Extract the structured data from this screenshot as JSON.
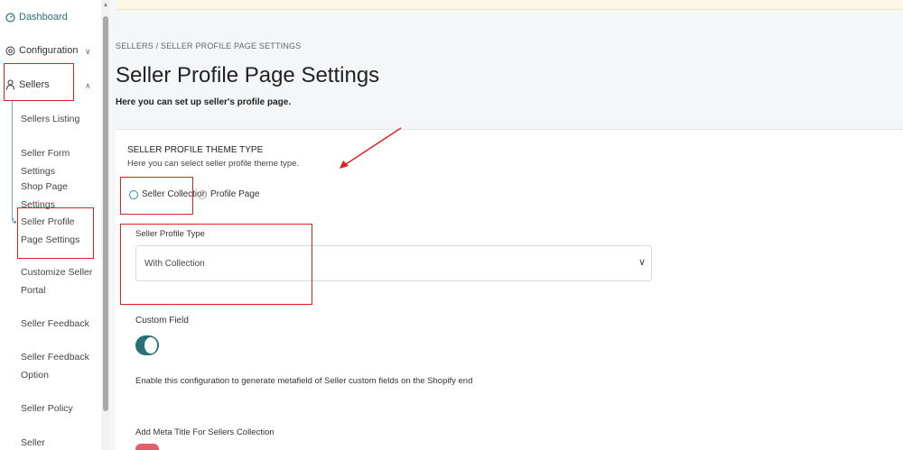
{
  "sidebar": {
    "dashboard": "Dashboard",
    "configuration": "Configuration",
    "sellers": "Sellers",
    "sub_items": [
      "Sellers Listing",
      "Seller Form Settings",
      "Shop Page Settings",
      "Seller Profile Page Settings",
      "Customize Seller Portal",
      "Seller Feedback",
      "Seller Feedback Option",
      "Seller Policy",
      "Seller Notifications"
    ]
  },
  "main": {
    "breadcrumb": "SELLERS / SELLER PROFILE PAGE SETTINGS",
    "title": "Seller Profile Page Settings",
    "subtitle": "Here you can set up seller's profile page.",
    "theme_section": {
      "title": "SELLER PROFILE THEME TYPE",
      "subtitle": "Here you can select seller profile theme type.",
      "options": [
        "Seller Collection",
        "Profile Page"
      ],
      "selected": "Seller Collection"
    },
    "profile_type": {
      "label": "Seller Profile Type",
      "value": "With Collection"
    },
    "custom_field": {
      "label": "Custom Field",
      "enabled": true,
      "help": "Enable this configuration to generate metafield of Seller custom fields on the Shopify end"
    },
    "meta_title": {
      "label": "Add Meta Title For Sellers Collection"
    }
  },
  "colors": {
    "accent": "#2b6f77",
    "annotation": "#e02020",
    "toggle_off": "#e35d6a"
  }
}
